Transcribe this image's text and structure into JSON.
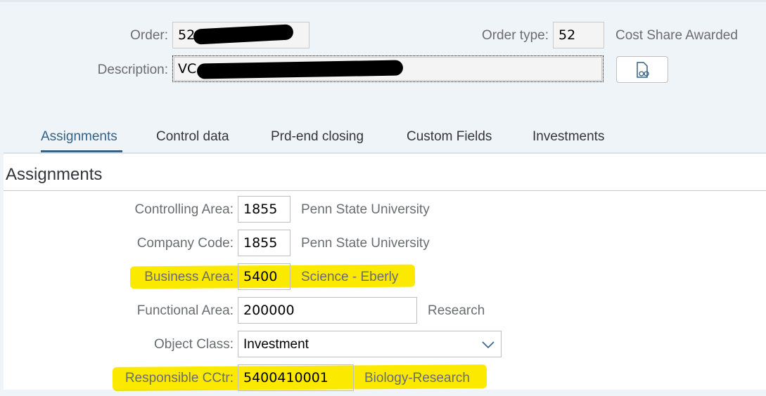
{
  "header": {
    "order_label": "Order:",
    "order_value": "52",
    "order_type_label": "Order type:",
    "order_type_value": "52",
    "order_type_text": "Cost Share Awarded",
    "description_label": "Description:",
    "description_value": "VC",
    "long_text_button_icon": "document-glasses-icon"
  },
  "tabs": [
    {
      "label": "Assignments",
      "active": true
    },
    {
      "label": "Control data"
    },
    {
      "label": "Prd-end closing"
    },
    {
      "label": "Custom Fields"
    },
    {
      "label": "Investments"
    }
  ],
  "section": {
    "title": "Assignments"
  },
  "fields": [
    {
      "label": "Controlling Area:",
      "value": "1855",
      "text": "Penn State University"
    },
    {
      "label": "Company Code:",
      "value": "1855",
      "text": "Penn State University"
    },
    {
      "label": "Business Area:",
      "value": "5400",
      "text": "Science - Eberly",
      "highlighted": true
    },
    {
      "label": "Functional Area:",
      "value": "200000",
      "text": "Research"
    },
    {
      "label": "Object Class:",
      "value": "Investment"
    },
    {
      "label": "Responsible CCtr:",
      "value": "5400410001",
      "text": "Biology-Research",
      "highlighted": true
    }
  ],
  "colors": {
    "accent": "#346187",
    "highlight": "#fbe900",
    "background": "#eff4f9"
  }
}
